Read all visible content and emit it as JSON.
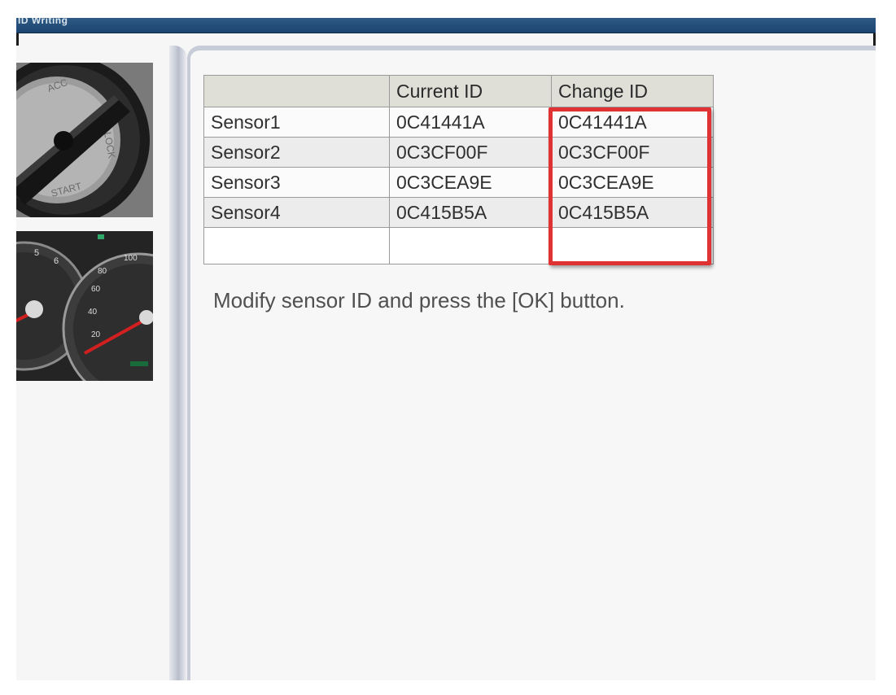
{
  "window": {
    "title": "ID Writing"
  },
  "images": {
    "ignition": "ignition-switch-photo",
    "gauges": "instrument-cluster-photo"
  },
  "table": {
    "headers": [
      "",
      "Current ID",
      "Change ID"
    ],
    "rows": [
      {
        "name": "Sensor1",
        "current": "0C41441A",
        "change": "0C41441A"
      },
      {
        "name": "Sensor2",
        "current": "0C3CF00F",
        "change": "0C3CF00F"
      },
      {
        "name": "Sensor3",
        "current": "0C3CEA9E",
        "change": "0C3CEA9E"
      },
      {
        "name": "Sensor4",
        "current": "0C415B5A",
        "change": "0C415B5A"
      }
    ]
  },
  "instruction": "Modify sensor ID and press the [OK] button.",
  "colors": {
    "highlight": "#e03232",
    "titlebar": "#2d5a86"
  }
}
